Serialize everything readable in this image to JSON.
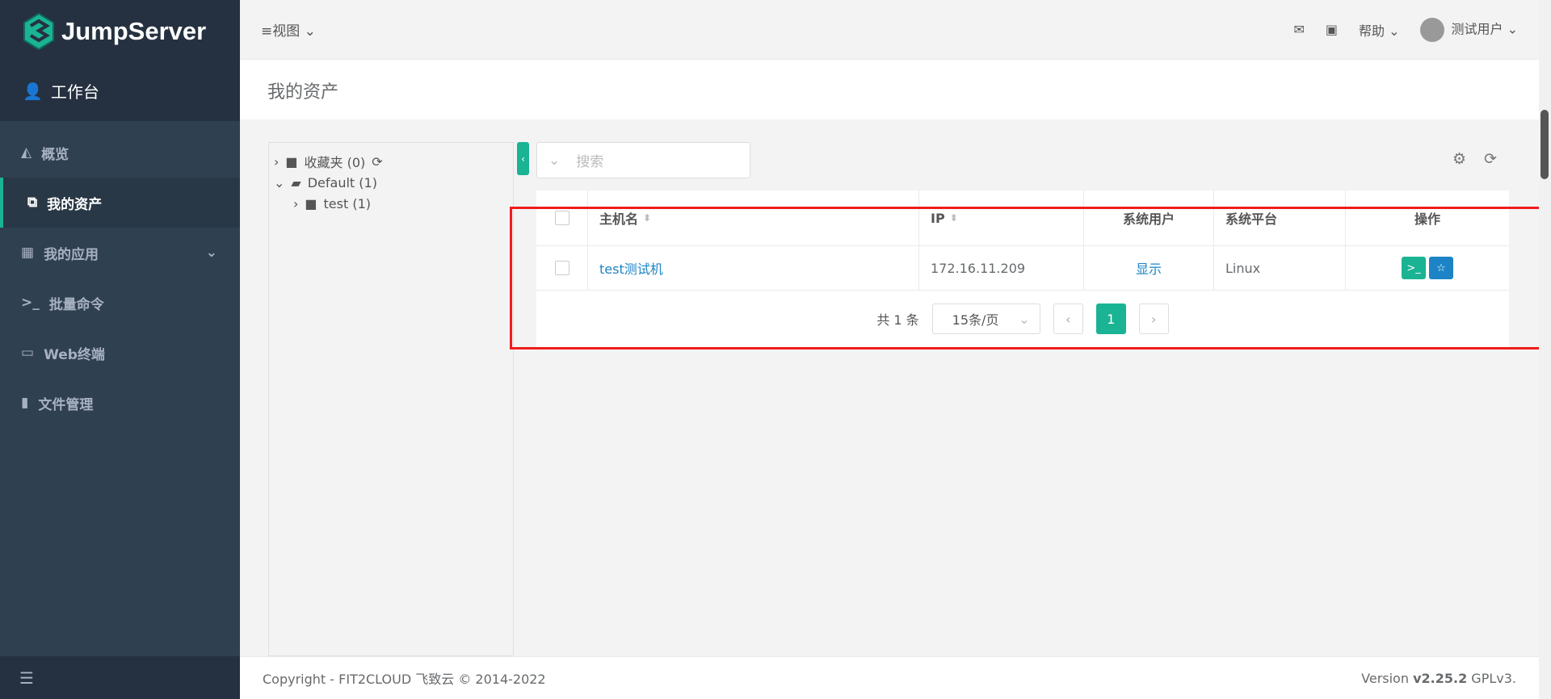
{
  "brand": {
    "name": "JumpServer",
    "color": "#1ab394"
  },
  "sidebar": {
    "workspace": "工作台",
    "items": [
      {
        "label": "概览",
        "icon": "chart-area-icon"
      },
      {
        "label": "我的资产",
        "icon": "copy-icon",
        "active": true
      },
      {
        "label": "我的应用",
        "icon": "grid-icon"
      },
      {
        "label": "批量命令",
        "icon": "terminal-icon"
      },
      {
        "label": "Web终端",
        "icon": "window-icon"
      },
      {
        "label": "文件管理",
        "icon": "file-icon"
      }
    ]
  },
  "topbar": {
    "view": "视图",
    "help": "帮助",
    "user": "测试用户"
  },
  "page": {
    "title": "我的资产"
  },
  "tree": {
    "nodes": [
      {
        "label": "收藏夹 (0)"
      },
      {
        "label": "Default (1)"
      },
      {
        "label": "test (1)"
      }
    ]
  },
  "search": {
    "placeholder": "搜索"
  },
  "table": {
    "headers": [
      "主机名",
      "IP",
      "系统用户",
      "系统平台",
      "操作"
    ],
    "rows": [
      {
        "hostname": "test测试机",
        "ip": "172.16.11.209",
        "system_user": "显示",
        "platform": "Linux"
      }
    ]
  },
  "pagination": {
    "total": "共 1 条",
    "page_size": "15条/页",
    "current": "1"
  },
  "footer": {
    "copyright": "Copyright - FIT2CLOUD 飞致云 © 2014-2022",
    "version_prefix": "Version",
    "version": "v2.25.2",
    "license": "GPLv3."
  }
}
